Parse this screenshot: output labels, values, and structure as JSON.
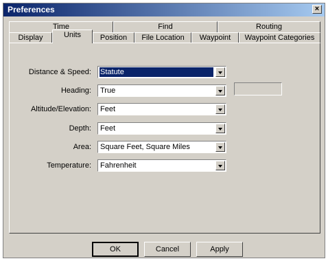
{
  "window": {
    "title": "Preferences",
    "close_label": "×"
  },
  "tabs_back": [
    {
      "label": "Time"
    },
    {
      "label": "Find"
    },
    {
      "label": "Routing"
    }
  ],
  "tabs_front": [
    {
      "label": "Display"
    },
    {
      "label": "Units"
    },
    {
      "label": "Position"
    },
    {
      "label": "File Location"
    },
    {
      "label": "Waypoint"
    },
    {
      "label": "Waypoint Categories"
    }
  ],
  "active_tab": "Units",
  "settings": [
    {
      "label": "Distance & Speed:",
      "value": "Statute"
    },
    {
      "label": "Heading:",
      "value": "True"
    },
    {
      "label": "Altitude/Elevation:",
      "value": "Feet"
    },
    {
      "label": "Depth:",
      "value": "Feet"
    },
    {
      "label": "Area:",
      "value": "Square Feet, Square Miles"
    },
    {
      "label": "Temperature:",
      "value": "Fahrenheit"
    }
  ],
  "buttons": {
    "ok": "OK",
    "cancel": "Cancel",
    "apply": "Apply"
  }
}
